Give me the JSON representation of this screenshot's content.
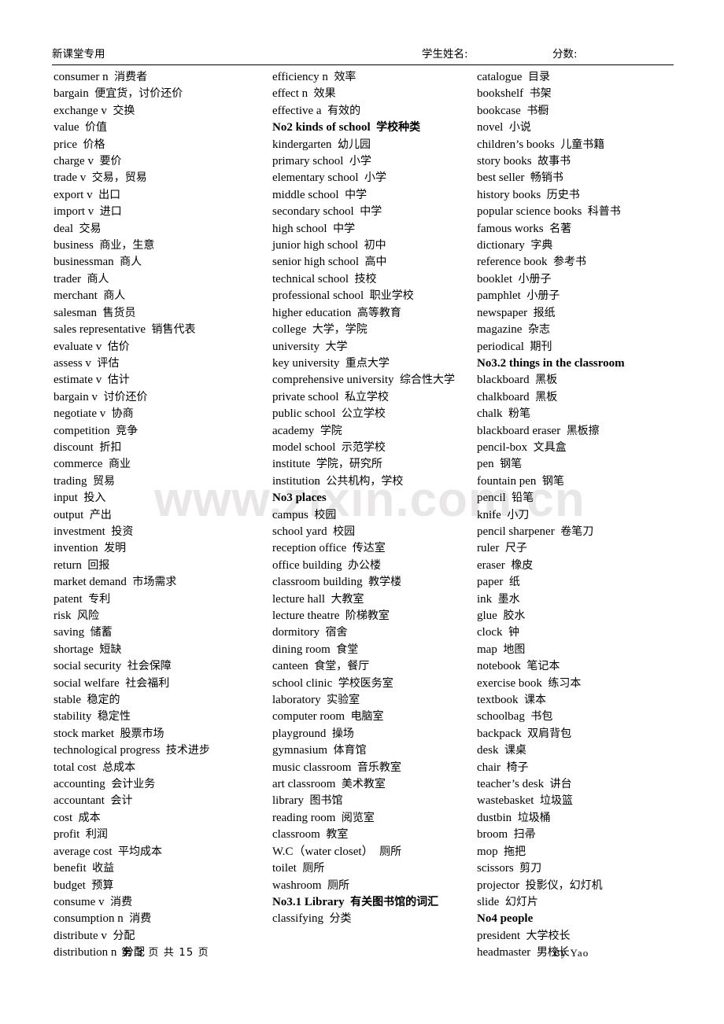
{
  "header": {
    "left_label": "新课堂专用",
    "student_name_label": "学生姓名:",
    "score_label": "分数:"
  },
  "watermark": {
    "text": "www.zixin.com.cn",
    "color": "#e8e6e6"
  },
  "footer": {
    "page_label": "第 3 页 共 15 页",
    "author": "By  Yao"
  },
  "columns": [
    {
      "id": "column-1",
      "entries": [
        {
          "en": "consumer n",
          "cn": "消费者",
          "bold": false
        },
        {
          "en": "bargain",
          "cn": "便宜货，讨价还价",
          "bold": false
        },
        {
          "en": "exchange v",
          "cn": "交换",
          "bold": false
        },
        {
          "en": "value",
          "cn": "价值",
          "bold": false
        },
        {
          "en": "price",
          "cn": "价格",
          "bold": false
        },
        {
          "en": "charge v",
          "cn": "要价",
          "bold": false
        },
        {
          "en": "trade v",
          "cn": "交易，贸易",
          "bold": false
        },
        {
          "en": "export v",
          "cn": "出口",
          "bold": false
        },
        {
          "en": "import v",
          "cn": "进口",
          "bold": false
        },
        {
          "en": "deal",
          "cn": "交易",
          "bold": false
        },
        {
          "en": "business",
          "cn": "商业，生意",
          "bold": false
        },
        {
          "en": "businessman",
          "cn": "商人",
          "bold": false
        },
        {
          "en": "trader",
          "cn": "商人",
          "bold": false
        },
        {
          "en": "merchant",
          "cn": "商人",
          "bold": false
        },
        {
          "en": "salesman",
          "cn": "售货员",
          "bold": false
        },
        {
          "en": "sales representative",
          "cn": "销售代表",
          "bold": false
        },
        {
          "en": "evaluate v",
          "cn": "估价",
          "bold": false
        },
        {
          "en": "assess v",
          "cn": "评估",
          "bold": false
        },
        {
          "en": "estimate v",
          "cn": "估计",
          "bold": false
        },
        {
          "en": "bargain v",
          "cn": "讨价还价",
          "bold": false
        },
        {
          "en": "negotiate v",
          "cn": "协商",
          "bold": false
        },
        {
          "en": "competition",
          "cn": "竞争",
          "bold": false
        },
        {
          "en": "discount",
          "cn": "折扣",
          "bold": false
        },
        {
          "en": "commerce",
          "cn": "商业",
          "bold": false
        },
        {
          "en": "trading",
          "cn": "贸易",
          "bold": false
        },
        {
          "en": "input",
          "cn": "投入",
          "bold": false
        },
        {
          "en": "output",
          "cn": "产出",
          "bold": false
        },
        {
          "en": "investment",
          "cn": "投资",
          "bold": false
        },
        {
          "en": "invention",
          "cn": "发明",
          "bold": false
        },
        {
          "en": "return",
          "cn": "回报",
          "bold": false
        },
        {
          "en": "market demand",
          "cn": "市场需求",
          "bold": false
        },
        {
          "en": "patent",
          "cn": "专利",
          "bold": false
        },
        {
          "en": "risk",
          "cn": "风险",
          "bold": false
        },
        {
          "en": "saving",
          "cn": "储蓄",
          "bold": false
        },
        {
          "en": "shortage",
          "cn": "短缺",
          "bold": false
        },
        {
          "en": "social security",
          "cn": "社会保障",
          "bold": false
        },
        {
          "en": "social welfare",
          "cn": "社会福利",
          "bold": false
        },
        {
          "en": "stable",
          "cn": "稳定的",
          "bold": false
        },
        {
          "en": "stability",
          "cn": "稳定性",
          "bold": false
        },
        {
          "en": "stock market",
          "cn": "股票市场",
          "bold": false
        },
        {
          "en": "technological progress",
          "cn": "技术进步",
          "bold": false
        },
        {
          "en": "total cost",
          "cn": "总成本",
          "bold": false
        },
        {
          "en": "accounting",
          "cn": "会计业务",
          "bold": false
        },
        {
          "en": "accountant",
          "cn": "会计",
          "bold": false
        },
        {
          "en": "cost",
          "cn": "成本",
          "bold": false
        },
        {
          "en": "profit",
          "cn": "利润",
          "bold": false
        },
        {
          "en": "average cost",
          "cn": "平均成本",
          "bold": false
        },
        {
          "en": "benefit",
          "cn": "收益",
          "bold": false
        },
        {
          "en": "budget",
          "cn": "预算",
          "bold": false
        },
        {
          "en": "consume v",
          "cn": "消费",
          "bold": false
        },
        {
          "en": "consumption n",
          "cn": "消费",
          "bold": false
        },
        {
          "en": "distribute v",
          "cn": "分配",
          "bold": false
        },
        {
          "en": "distribution n",
          "cn": "分配",
          "bold": false
        }
      ]
    },
    {
      "id": "column-2",
      "entries": [
        {
          "en": "efficiency n",
          "cn": "效率",
          "bold": false
        },
        {
          "en": "effect n",
          "cn": "效果",
          "bold": false
        },
        {
          "en": "effective a",
          "cn": "有效的",
          "bold": false
        },
        {
          "en": "No2 kinds of school",
          "cn": "学校种类",
          "bold": true
        },
        {
          "en": "kindergarten",
          "cn": "幼儿园",
          "bold": false
        },
        {
          "en": "primary school",
          "cn": "小学",
          "bold": false
        },
        {
          "en": "elementary school",
          "cn": "小学",
          "bold": false
        },
        {
          "en": "middle school",
          "cn": "中学",
          "bold": false
        },
        {
          "en": "secondary school",
          "cn": "中学",
          "bold": false
        },
        {
          "en": "high school",
          "cn": "中学",
          "bold": false
        },
        {
          "en": "junior high school",
          "cn": "初中",
          "bold": false
        },
        {
          "en": "senior high school",
          "cn": "高中",
          "bold": false
        },
        {
          "en": "technical school",
          "cn": "技校",
          "bold": false
        },
        {
          "en": "professional school",
          "cn": "职业学校",
          "bold": false
        },
        {
          "en": "higher education",
          "cn": "高等教育",
          "bold": false
        },
        {
          "en": "college",
          "cn": "大学，学院",
          "bold": false
        },
        {
          "en": "university",
          "cn": "大学",
          "bold": false
        },
        {
          "en": "key university",
          "cn": "重点大学",
          "bold": false
        },
        {
          "en": "comprehensive university",
          "cn": "综合性大学",
          "bold": false
        },
        {
          "en": "private school",
          "cn": "私立学校",
          "bold": false
        },
        {
          "en": "public school",
          "cn": "公立学校",
          "bold": false
        },
        {
          "en": "academy",
          "cn": "学院",
          "bold": false
        },
        {
          "en": "model school",
          "cn": "示范学校",
          "bold": false
        },
        {
          "en": "institute",
          "cn": "学院，研究所",
          "bold": false
        },
        {
          "en": "institution",
          "cn": "公共机构，学校",
          "bold": false
        },
        {
          "en": "No3 places",
          "cn": "",
          "bold": true
        },
        {
          "en": "campus",
          "cn": "校园",
          "bold": false
        },
        {
          "en": "school yard",
          "cn": "校园",
          "bold": false
        },
        {
          "en": "reception office",
          "cn": "传达室",
          "bold": false
        },
        {
          "en": "office building",
          "cn": "办公楼",
          "bold": false
        },
        {
          "en": "classroom building",
          "cn": "教学楼",
          "bold": false
        },
        {
          "en": "lecture hall",
          "cn": "大教室",
          "bold": false
        },
        {
          "en": "lecture theatre",
          "cn": "阶梯教室",
          "bold": false
        },
        {
          "en": "dormitory",
          "cn": "宿舍",
          "bold": false
        },
        {
          "en": "dining room",
          "cn": "食堂",
          "bold": false
        },
        {
          "en": "canteen",
          "cn": "食堂，餐厅",
          "bold": false
        },
        {
          "en": "school clinic",
          "cn": "学校医务室",
          "bold": false
        },
        {
          "en": "laboratory",
          "cn": "实验室",
          "bold": false
        },
        {
          "en": "computer room",
          "cn": "电脑室",
          "bold": false
        },
        {
          "en": "playground",
          "cn": "操场",
          "bold": false
        },
        {
          "en": "gymnasium",
          "cn": "体育馆",
          "bold": false
        },
        {
          "en": "music classroom",
          "cn": "音乐教室",
          "bold": false
        },
        {
          "en": "art classroom",
          "cn": "美术教室",
          "bold": false
        },
        {
          "en": "library",
          "cn": "图书馆",
          "bold": false
        },
        {
          "en": "reading room",
          "cn": "阅览室",
          "bold": false
        },
        {
          "en": "classroom",
          "cn": "教室",
          "bold": false
        },
        {
          "en": "W.C（water closet）",
          "cn": "厕所",
          "bold": false
        },
        {
          "en": "toilet",
          "cn": "厕所",
          "bold": false
        },
        {
          "en": "washroom",
          "cn": "厕所",
          "bold": false
        },
        {
          "en": "No3.1 Library",
          "cn": "有关图书馆的词汇",
          "bold": true
        },
        {
          "en": "classifying",
          "cn": "分类",
          "bold": false
        }
      ]
    },
    {
      "id": "column-3",
      "entries": [
        {
          "en": "catalogue",
          "cn": "目录",
          "bold": false
        },
        {
          "en": "bookshelf",
          "cn": "书架",
          "bold": false
        },
        {
          "en": "bookcase",
          "cn": "书橱",
          "bold": false
        },
        {
          "en": "novel",
          "cn": "小说",
          "bold": false
        },
        {
          "en": "children’s books",
          "cn": "儿童书籍",
          "bold": false
        },
        {
          "en": "story books",
          "cn": "故事书",
          "bold": false
        },
        {
          "en": "best seller",
          "cn": "畅销书",
          "bold": false
        },
        {
          "en": "history books",
          "cn": "历史书",
          "bold": false
        },
        {
          "en": "popular science books",
          "cn": "科普书",
          "bold": false
        },
        {
          "en": "famous works",
          "cn": "名著",
          "bold": false
        },
        {
          "en": "dictionary",
          "cn": "字典",
          "bold": false
        },
        {
          "en": "reference book",
          "cn": "参考书",
          "bold": false
        },
        {
          "en": "booklet",
          "cn": "小册子",
          "bold": false
        },
        {
          "en": "pamphlet",
          "cn": "小册子",
          "bold": false
        },
        {
          "en": "newspaper",
          "cn": "报纸",
          "bold": false
        },
        {
          "en": "magazine",
          "cn": "杂志",
          "bold": false
        },
        {
          "en": "periodical",
          "cn": "期刊",
          "bold": false
        },
        {
          "en": "No3.2 things in the classroom",
          "cn": "",
          "bold": true
        },
        {
          "en": "blackboard",
          "cn": "黑板",
          "bold": false
        },
        {
          "en": "chalkboard",
          "cn": "黑板",
          "bold": false
        },
        {
          "en": "chalk",
          "cn": "粉笔",
          "bold": false
        },
        {
          "en": "blackboard eraser",
          "cn": "黑板擦",
          "bold": false
        },
        {
          "en": "pencil-box",
          "cn": "文具盒",
          "bold": false
        },
        {
          "en": "pen",
          "cn": "钢笔",
          "bold": false
        },
        {
          "en": "fountain pen",
          "cn": "钢笔",
          "bold": false
        },
        {
          "en": "pencil",
          "cn": "铅笔",
          "bold": false
        },
        {
          "en": "knife",
          "cn": "小刀",
          "bold": false
        },
        {
          "en": "pencil sharpener",
          "cn": "卷笔刀",
          "bold": false
        },
        {
          "en": "ruler",
          "cn": "尺子",
          "bold": false
        },
        {
          "en": "eraser",
          "cn": "橡皮",
          "bold": false
        },
        {
          "en": "paper",
          "cn": "纸",
          "bold": false
        },
        {
          "en": "ink",
          "cn": "墨水",
          "bold": false
        },
        {
          "en": "glue",
          "cn": "胶水",
          "bold": false
        },
        {
          "en": "clock",
          "cn": "钟",
          "bold": false
        },
        {
          "en": "map",
          "cn": "地图",
          "bold": false
        },
        {
          "en": "notebook",
          "cn": "笔记本",
          "bold": false
        },
        {
          "en": "exercise book",
          "cn": "练习本",
          "bold": false
        },
        {
          "en": "textbook",
          "cn": "课本",
          "bold": false
        },
        {
          "en": "schoolbag",
          "cn": "书包",
          "bold": false
        },
        {
          "en": "backpack",
          "cn": "双肩背包",
          "bold": false
        },
        {
          "en": "desk",
          "cn": "课桌",
          "bold": false
        },
        {
          "en": "chair",
          "cn": "椅子",
          "bold": false
        },
        {
          "en": "teacher’s desk",
          "cn": "讲台",
          "bold": false
        },
        {
          "en": "wastebasket",
          "cn": "垃圾篮",
          "bold": false
        },
        {
          "en": "dustbin",
          "cn": "垃圾桶",
          "bold": false
        },
        {
          "en": "broom",
          "cn": "扫帚",
          "bold": false
        },
        {
          "en": "mop",
          "cn": "拖把",
          "bold": false
        },
        {
          "en": "scissors",
          "cn": "剪刀",
          "bold": false
        },
        {
          "en": "projector",
          "cn": "投影仪，幻灯机",
          "bold": false
        },
        {
          "en": "slide",
          "cn": "幻灯片",
          "bold": false
        },
        {
          "en": "No4 people",
          "cn": "",
          "bold": true
        },
        {
          "en": "president",
          "cn": "大学校长",
          "bold": false
        },
        {
          "en": "headmaster",
          "cn": "男校长",
          "bold": false
        }
      ]
    }
  ]
}
